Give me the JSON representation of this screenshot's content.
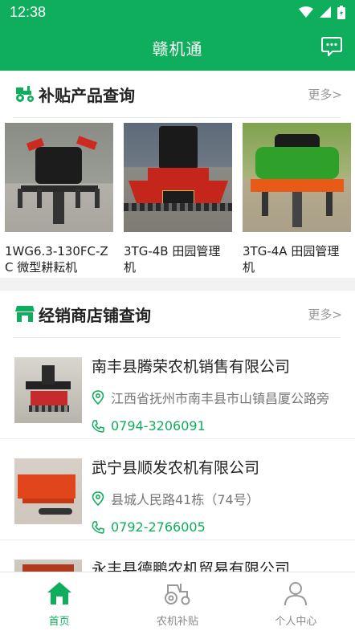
{
  "status": {
    "time": "12:38"
  },
  "header": {
    "title": "赣机通"
  },
  "products_section": {
    "title": "补贴产品查询",
    "more": "更多>",
    "items": [
      {
        "name": "1WG6.3-130FC-ZC 微型耕耘机"
      },
      {
        "name": "3TG-4B 田园管理机"
      },
      {
        "name": "3TG-4A 田园管理机"
      }
    ]
  },
  "dealers_section": {
    "title": "经销商店铺查询",
    "more": "更多>",
    "items": [
      {
        "name": "南丰县腾荣农机销售有限公司",
        "address": "江西省抚州市南丰县市山镇昌厦公路旁",
        "phone": "0794-3206091"
      },
      {
        "name": "武宁县顺发农机有限公司",
        "address": "县城人民路41栋（74号）",
        "phone": "0792-2766005"
      },
      {
        "name": "永丰县德鹏农机贸易有限公司",
        "address": "",
        "phone": ""
      }
    ]
  },
  "tabbar": {
    "tabs": [
      {
        "label": "首页",
        "icon": "home-icon"
      },
      {
        "label": "农机补贴",
        "icon": "tractor-icon"
      },
      {
        "label": "个人中心",
        "icon": "person-icon"
      }
    ]
  },
  "colors": {
    "brand": "#0fae5c"
  }
}
